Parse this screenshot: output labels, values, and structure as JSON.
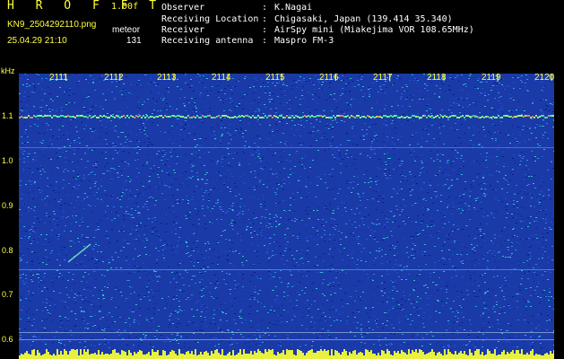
{
  "header": {
    "title": "H R O F F T",
    "version": "1.00f",
    "filename": "KN9_2504292110.png",
    "meteor_label": "meteor",
    "datetime": "25.04.29 21:10",
    "count": "131"
  },
  "info": [
    {
      "label": "Observer",
      "value": "K.Nagai"
    },
    {
      "label": "Receiving Location",
      "value": "Chigasaki, Japan (139.414 35.340)"
    },
    {
      "label": "Receiver",
      "value": "AirSpy mini (Miakejima VOR 108.65MHz)"
    },
    {
      "label": "Receiving antenna",
      "value": "Maspro FM-3"
    }
  ],
  "separator": ":",
  "axis": {
    "unit": "kHz",
    "y_ticks": [
      "1.1",
      "1.0",
      "0.9",
      "0.8",
      "0.7",
      "0.6"
    ],
    "x_ticks": [
      "2111",
      "2112",
      "2113",
      "2114",
      "2115",
      "2116",
      "2117",
      "2118",
      "2119",
      "2120"
    ]
  },
  "colors": {
    "background": "#000000",
    "spectrogram_base": "#1a3aa8",
    "label": "#ffff3c",
    "signal": "#40e0a0"
  }
}
